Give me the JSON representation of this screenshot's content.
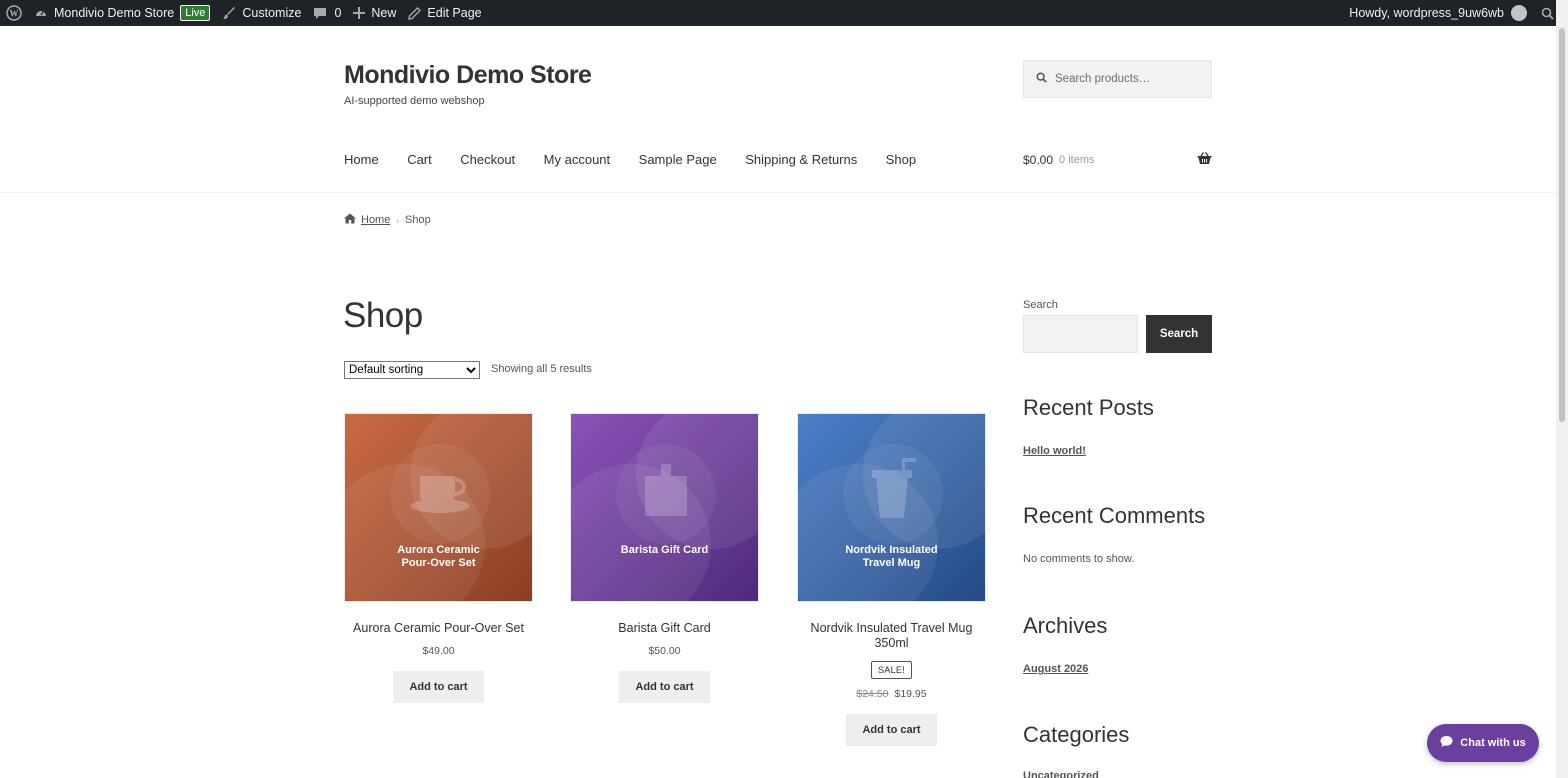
{
  "adminbar": {
    "site_name": "Mondivio Demo Store",
    "live_badge": "Live",
    "customize": "Customize",
    "comments_count": "0",
    "new": "New",
    "edit_page": "Edit Page",
    "howdy": "Howdy, wordpress_9uw6wb"
  },
  "header": {
    "site_title": "Mondivio Demo Store",
    "tagline": "AI-supported demo webshop",
    "search_placeholder": "Search products…",
    "nav": [
      "Home",
      "Cart",
      "Checkout",
      "My account",
      "Sample Page",
      "Shipping & Returns",
      "Shop"
    ],
    "cart_total": "$0.00",
    "cart_items": "0 items"
  },
  "breadcrumb": {
    "home": "Home",
    "current": "Shop"
  },
  "main": {
    "title": "Shop",
    "sorting_selected": "Default sorting",
    "result_count": "Showing all 5 results",
    "products": [
      {
        "thumb_line1": "Aurora Ceramic",
        "thumb_line2": "Pour-Over Set",
        "name": "Aurora Ceramic Pour-Over Set",
        "price": "$49.00",
        "button": "Add to cart",
        "colors": [
          "#c96a45",
          "#8b3e22"
        ]
      },
      {
        "thumb_line1": "Barista Gift Card",
        "thumb_line2": "",
        "name": "Barista Gift Card",
        "price": "$50.00",
        "button": "Add to cart",
        "colors": [
          "#8a52b8",
          "#4e2a7a"
        ]
      },
      {
        "thumb_line1": "Nordvik Insulated",
        "thumb_line2": "Travel Mug",
        "name_line1": "Nordvik Insulated Travel Mug",
        "name_line2": "350ml",
        "sale_badge": "SALE!",
        "old_price": "$24.50",
        "price": "$19.95",
        "button": "Add to cart",
        "colors": [
          "#4c7fc8",
          "#244a86"
        ]
      }
    ]
  },
  "sidebar": {
    "search_label": "Search",
    "search_button": "Search",
    "recent_posts_heading": "Recent Posts",
    "recent_post": "Hello world!",
    "recent_comments_heading": "Recent Comments",
    "no_comments": "No comments to show.",
    "archives_heading": "Archives",
    "archive_item": "August 2026",
    "categories_heading": "Categories",
    "category_item": "Uncategorized"
  },
  "chat": {
    "label": "Chat with us"
  }
}
